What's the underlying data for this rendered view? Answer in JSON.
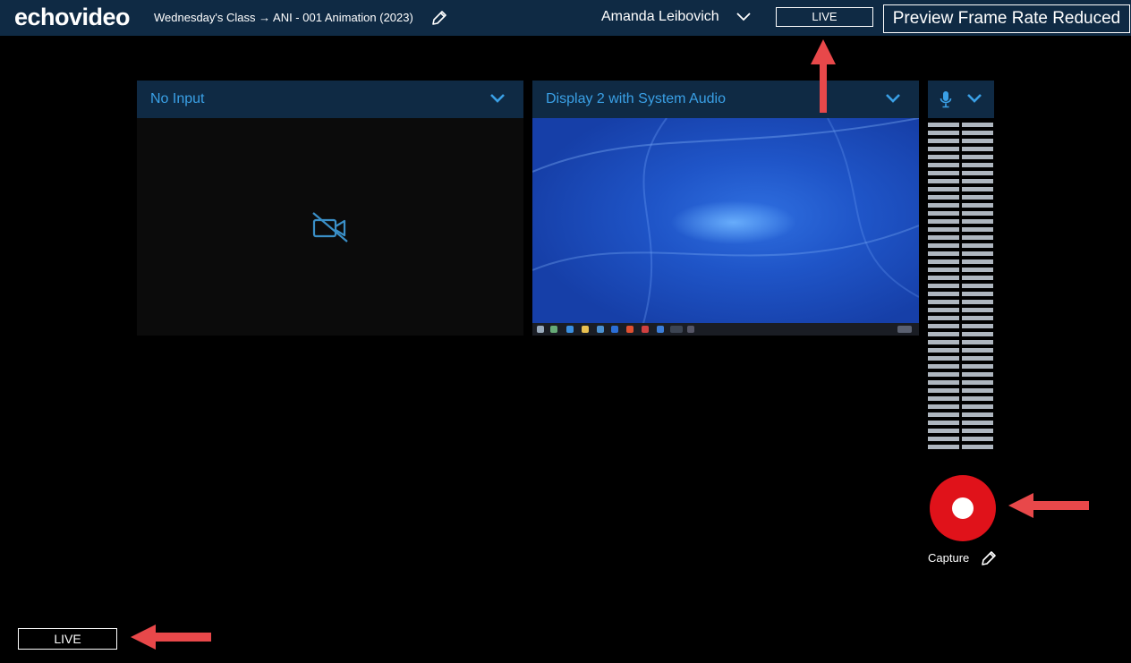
{
  "header": {
    "logo": "echovideo",
    "breadcrumb": "Wednesday's Class → ANI - 001 Animation (2023)",
    "user_name": "Amanda Leibovich",
    "live_label": "LIVE",
    "preview_notice": "Preview Frame Rate Reduced",
    "icons": [
      "pencil-icon",
      "chevron-down-icon"
    ]
  },
  "sources": [
    {
      "title": "No Input",
      "icon": "video-off-icon"
    },
    {
      "title": "Display 2 with System Audio",
      "preview": "desktop-screenshot"
    }
  ],
  "audio": {
    "icons": [
      "microphone-icon",
      "chevron-down-icon"
    ]
  },
  "capture": {
    "label": "Capture",
    "icon": "pencil-icon"
  },
  "footer": {
    "live_label": "LIVE"
  },
  "colors": {
    "topbar": "#0f2a44",
    "accent": "#3aa0e6",
    "record": "#e0121a",
    "arrow": "#e8484a",
    "meter": "#aeb6bf"
  }
}
